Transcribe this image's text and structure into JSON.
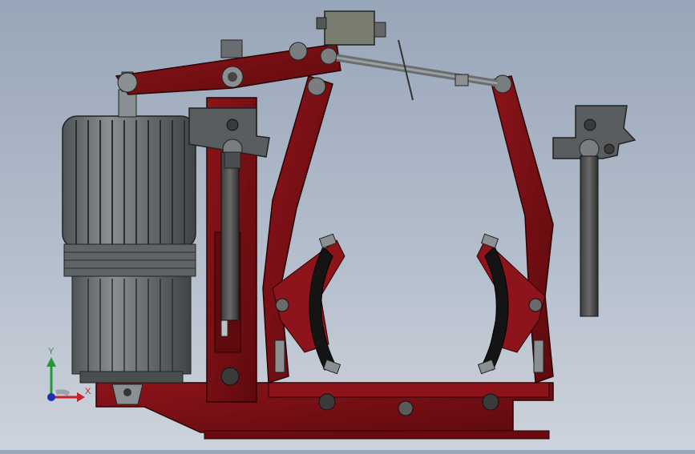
{
  "viewport": {
    "background_top": "#98a6b9",
    "background_bottom": "#cdd3dc",
    "model_colors": {
      "frame_red": "#7a0f14",
      "frame_dark": "#4a070a",
      "motor_gray": "#6b7072",
      "steel": "#8a8f92",
      "lining_black": "#141414"
    }
  },
  "triad": {
    "y_label": "Y",
    "x_label": "X",
    "y_color": "#1f9a35",
    "x_color": "#c8202a",
    "z_color": "#1f2fb0"
  }
}
